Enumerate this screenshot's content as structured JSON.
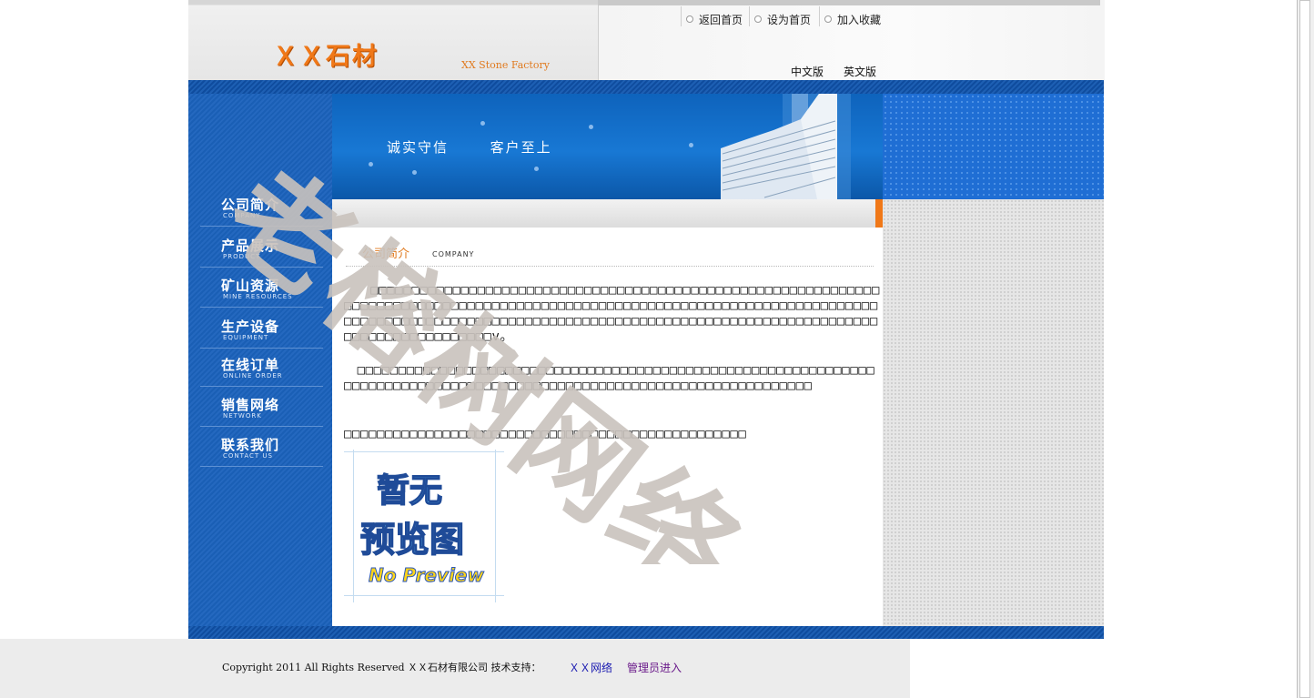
{
  "header": {
    "logo": "ＸＸ石材",
    "logo_en": "XX Stone Factory",
    "top_links": [
      {
        "label": "返回首页",
        "icon": "dot-icon"
      },
      {
        "label": "设为首页",
        "icon": "dot-icon"
      },
      {
        "label": "加入收藏",
        "icon": "dot-icon"
      }
    ],
    "languages": [
      {
        "label": "中文版"
      },
      {
        "label": "英文版"
      }
    ]
  },
  "banner": {
    "slogan_1": "诚实守信",
    "slogan_2": "客户至上"
  },
  "nav": {
    "items": [
      {
        "cn": "公司简介",
        "en": "COMPANY"
      },
      {
        "cn": "产品展示",
        "en": "PRODUCT"
      },
      {
        "cn": "矿山资源",
        "en": "MINE RESOURCES"
      },
      {
        "cn": "生产设备",
        "en": "EQUIPMENT"
      },
      {
        "cn": "在线订单",
        "en": "ONLINE ORDER"
      },
      {
        "cn": "销售网络",
        "en": "NETWORK"
      },
      {
        "cn": "联系我们",
        "en": "CONTACT US"
      }
    ]
  },
  "content": {
    "section_title": "公司简介",
    "section_title_en": "COMPANY",
    "paragraph_1": "　　□□□□□□□□□□□□□□□□□□□□□□□□□□□□□□□□□□□□□□□□□□□□□□□□□□□□□□□□□□□□□□□□□□□□□□□□□□□□□□□□□□□□□□□□□□□□□□□□□□□□□□□□□□□□□□□□□□□□□□□□□□□□□□□□□□□□□□□□□□□□□□□□□□□□□□□□□□□□□□□□□□□□□□□□□□□□□□□□□□□□□□□□□□□□□□□□□□□□□□□□□□□□□□□□□□v。",
    "paragraph_2": "　□□□□□□□□□□□□□□□□□□□□□□□□□□□□□□□□□□□□□□□□□□□□□□□□□□□□□□□□□□□□□□□□□□□□□□□□□□□□□□□□□□□□□□□□□□□□□□□□□□□□□□□□□□□□□□□□□□□□□□□□",
    "paragraph_3": "□□□□□□□□□□□□□□□□□□□□□□□□□□□□□□□□□□□□□□□□□□□□□□□□□",
    "preview": {
      "cn_line_1": "暂无",
      "cn_line_2": "预览图",
      "en_line": "No Preview"
    }
  },
  "footer": {
    "copyright": "Copyright 2011 All Rights Reserved ＸＸ石材有限公司 技术支持：",
    "support_link": "ＸＸ网络",
    "admin_link": "管理员进入",
    "link_colors": {
      "support": "#1a1ab0",
      "admin": "#6a1a8a"
    }
  },
  "watermark": "老榕树网络",
  "colors": {
    "accent_orange": "#f07818",
    "brand_blue": "#1a5fb5"
  }
}
